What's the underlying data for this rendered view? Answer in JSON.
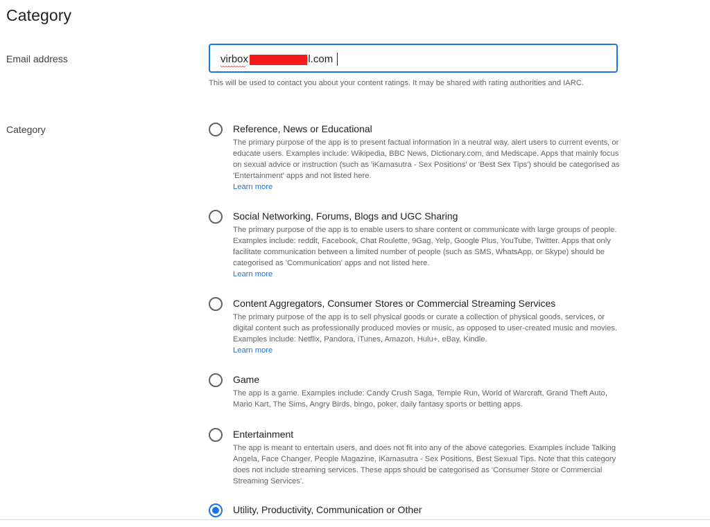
{
  "page": {
    "title": "Category"
  },
  "email": {
    "label": "Email address",
    "value_prefix": "virbox",
    "value_suffix": "il.com",
    "helper": "This will be used to contact you about your content ratings. It may be shared with rating authorities and IARC."
  },
  "category": {
    "label": "Category",
    "options": [
      {
        "title": "Reference, News or Educational",
        "description": "The primary purpose of the app is to present factual information in a neutral way, alert users to current events, or educate users. Examples include: Wikipedia, BBC News, Dictionary.com, and Medscape. Apps that mainly focus on sexual advice or instruction (such as 'iKamasutra - Sex Positions' or 'Best Sex Tips') should be categorised as 'Entertainment' apps and not listed here.",
        "link": "Learn more",
        "selected": false
      },
      {
        "title": "Social Networking, Forums, Blogs and UGC Sharing",
        "description": "The primary purpose of the app is to enable users to share content or communicate with large groups of people. Examples include: reddit, Facebook, Chat Roulette, 9Gag, Yelp, Google Plus, YouTube, Twitter. Apps that only facilitate communication between a limited number of people (such as SMS, WhatsApp, or Skype) should be categorised as 'Communication' apps and not listed here.",
        "link": "Learn more",
        "selected": false
      },
      {
        "title": "Content Aggregators, Consumer Stores or Commercial Streaming Services",
        "description": "The primary purpose of the app is to sell physical goods or curate a collection of physical goods, services, or digital content such as professionally produced movies or music, as opposed to user-created music and movies. Examples include: Netflix, Pandora, iTunes, Amazon, Hulu+, eBay, Kindle.",
        "link": "Learn more",
        "selected": false
      },
      {
        "title": "Game",
        "description": "The app is a game. Examples include: Candy Crush Saga, Temple Run, World of Warcraft, Grand Theft Auto, Mario Kart, The Sims, Angry Birds, bingo, poker, daily fantasy sports or betting apps.",
        "selected": false
      },
      {
        "title": "Entertainment",
        "description": "The app is meant to entertain users, and does not fit into any of the above categories. Examples include Talking Angela, Face Changer, People Magazine, iKamasutra - Sex Positions, Best Sexual Tips. Note that this category does not include streaming services. These apps should be categorised as 'Consumer Store or Commercial Streaming Services'.",
        "selected": false
      },
      {
        "title": "Utility, Productivity, Communication or Other",
        "selected": true
      }
    ]
  },
  "colors": {
    "accent": "#1a73e8",
    "redaction": "#f51b1b"
  }
}
